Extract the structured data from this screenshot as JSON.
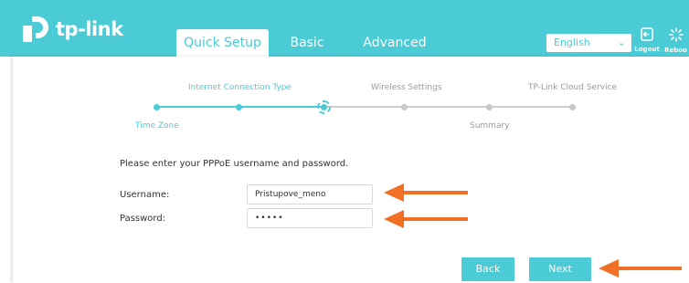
{
  "brand": {
    "logo_text": "tp-link"
  },
  "tabs": [
    {
      "label": "Quick Setup",
      "active": true
    },
    {
      "label": "Basic",
      "active": false
    },
    {
      "label": "Advanced",
      "active": false
    }
  ],
  "header": {
    "language": "English",
    "logout_label": "Logout",
    "reboot_label": "Reboo"
  },
  "wizard": {
    "steps": [
      {
        "label": "Time Zone",
        "status": "done"
      },
      {
        "label": "Internet Connection Type",
        "status": "done"
      },
      {
        "label": "",
        "status": "current"
      },
      {
        "label": "Wireless Settings",
        "status": "pending"
      },
      {
        "label": "Summary",
        "status": "pending"
      },
      {
        "label": "TP-Link Cloud Service",
        "status": "pending"
      }
    ]
  },
  "form": {
    "instruction": "Please enter your PPPoE username and password.",
    "username_label": "Username:",
    "username_value": "Pristupove_meno",
    "password_label": "Password:",
    "password_value": "•••••"
  },
  "buttons": {
    "back": "Back",
    "next": "Next"
  },
  "colors": {
    "accent": "#4acbd6",
    "arrow": "#f07125",
    "inactive": "#c8c8c8"
  },
  "annotation_arrows": [
    "username-field",
    "password-field",
    "next-button"
  ]
}
